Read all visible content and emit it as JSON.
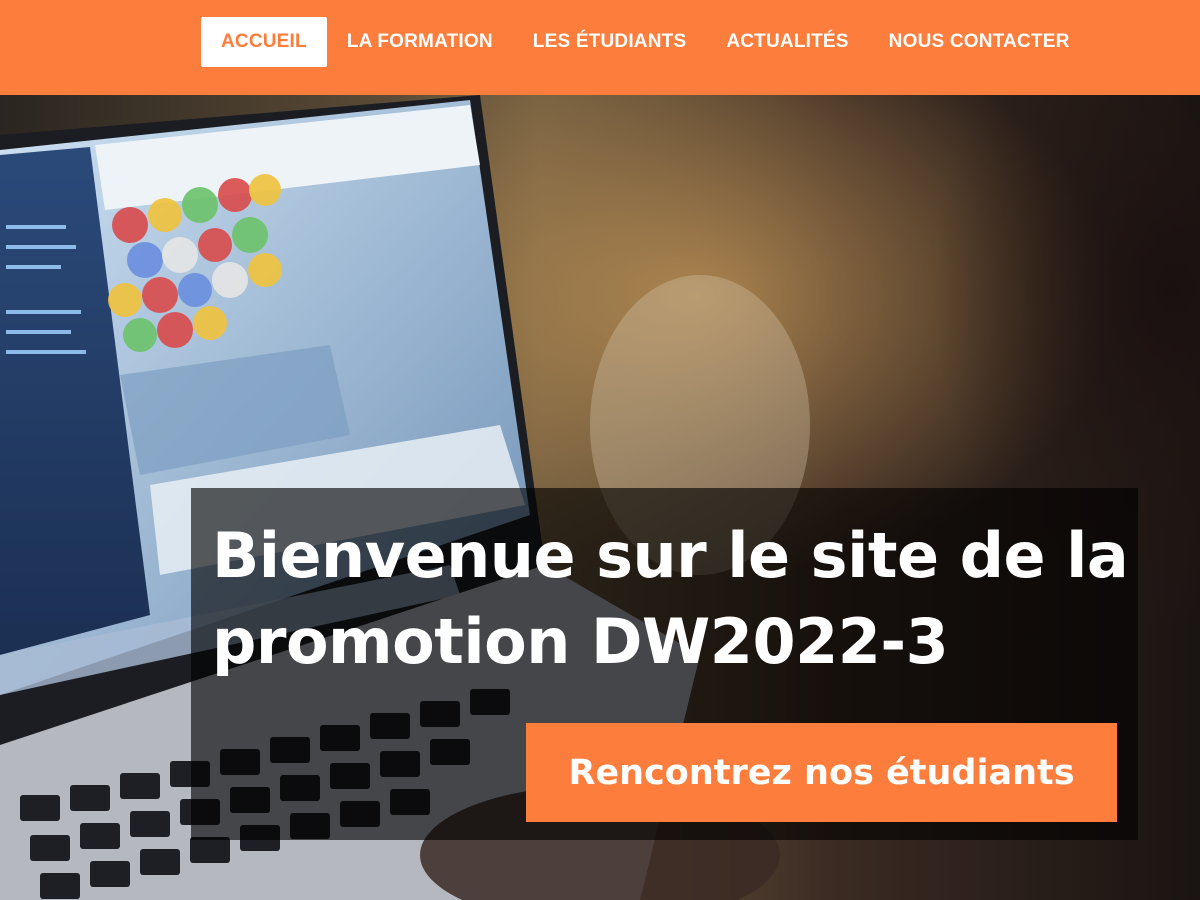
{
  "nav": {
    "items": [
      {
        "label": "ACCUEIL",
        "active": true
      },
      {
        "label": "LA FORMATION",
        "active": false
      },
      {
        "label": "LES ÉTUDIANTS",
        "active": false
      },
      {
        "label": "ACTUALITÉS",
        "active": false
      },
      {
        "label": "NOUS CONTACTER",
        "active": false
      }
    ]
  },
  "hero": {
    "title": "Bienvenue sur le site de la promotion DW2022-3",
    "cta_label": "Rencontrez nos étudiants",
    "image": "laptop-workspace-photo"
  },
  "colors": {
    "accent": "#fd7e3c",
    "white": "#ffffff",
    "overlay": "rgba(0,0,0,0.62)"
  }
}
